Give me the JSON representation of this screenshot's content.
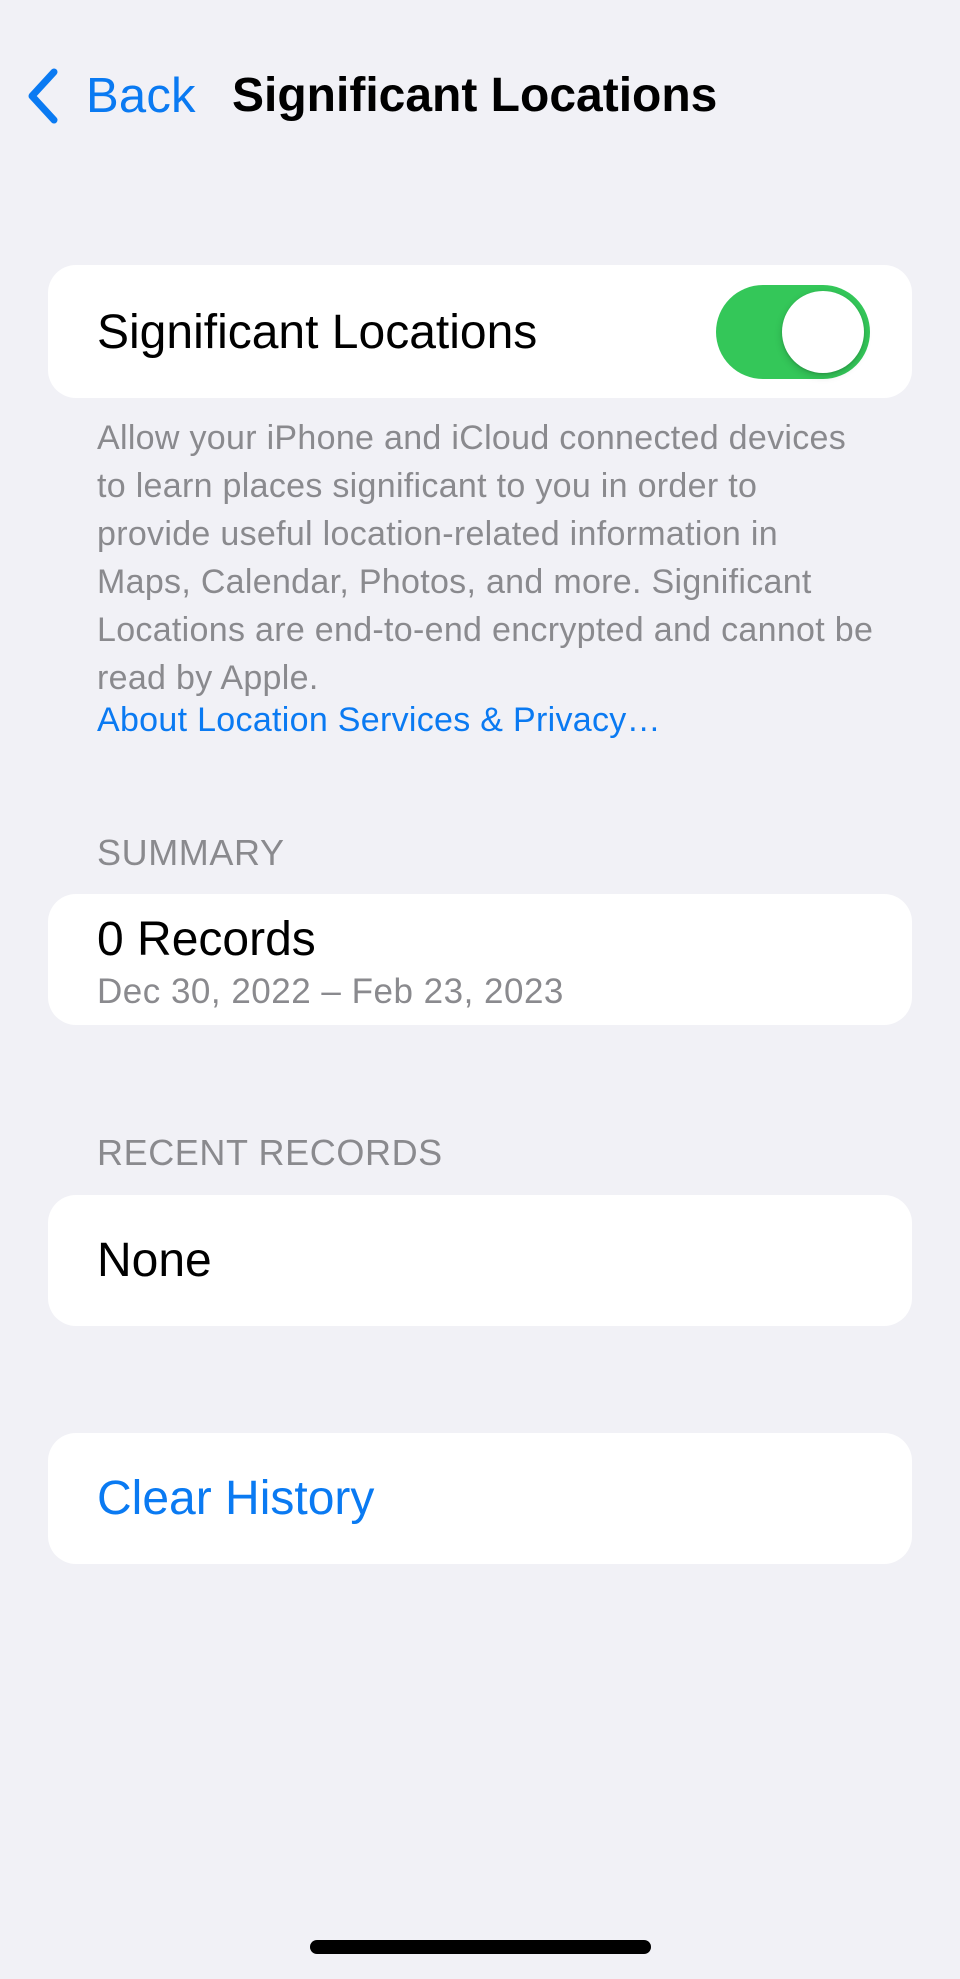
{
  "nav": {
    "back_label": "Back",
    "title": "Significant Locations",
    "back_icon": "chevron-left-icon"
  },
  "toggle_row": {
    "label": "Significant Locations",
    "enabled": true,
    "on_color": "#34C759"
  },
  "description": {
    "text": "Allow your iPhone and iCloud connected devices to learn places significant to you in order to provide useful location-related information in Maps, Calendar, Photos, and more. Significant Locations are end-to-end encrypted and cannot be read by Apple.",
    "link": "About Location Services & Privacy…"
  },
  "summary": {
    "header": "SUMMARY",
    "records": "0 Records",
    "date_range": "Dec 30, 2022 – Feb 23, 2023"
  },
  "recent_records": {
    "header": "RECENT RECORDS",
    "value": "None"
  },
  "clear_history": {
    "label": "Clear History"
  },
  "colors": {
    "accent": "#0A7AF2",
    "background": "#F1F1F6",
    "secondary_text": "#8A8A8E"
  }
}
